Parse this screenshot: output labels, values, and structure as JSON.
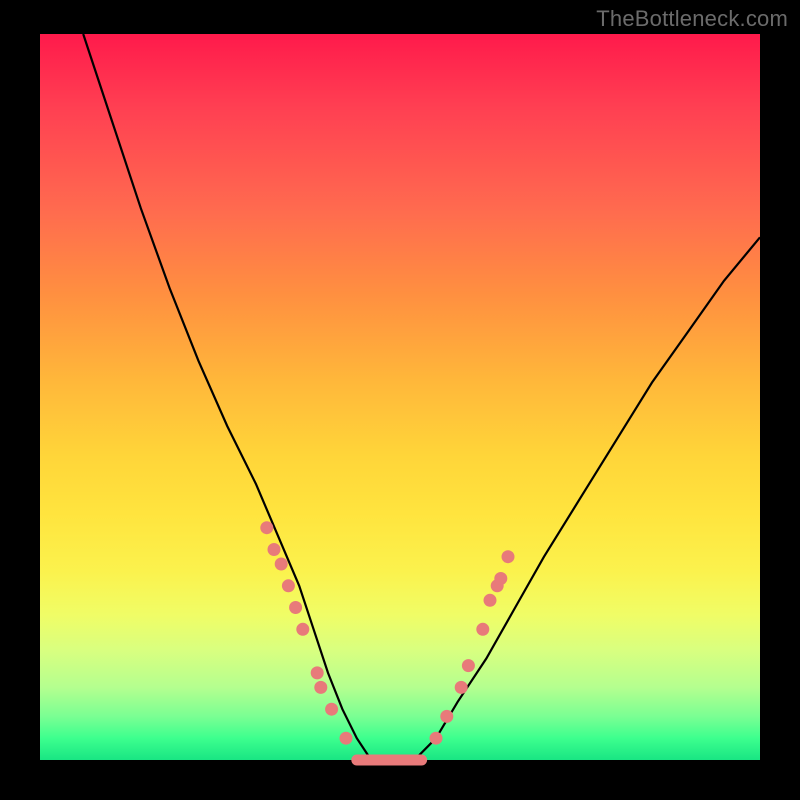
{
  "watermark": "TheBottleneck.com",
  "colors": {
    "dot": "#e87a7a",
    "curve": "#000000",
    "frame": "#000000"
  },
  "chart_data": {
    "type": "line",
    "title": "",
    "xlabel": "",
    "ylabel": "",
    "xlim": [
      0,
      100
    ],
    "ylim": [
      0,
      100
    ],
    "background": "vertical-rainbow-gradient (red→orange→yellow→green)",
    "series": [
      {
        "name": "bottleneck-curve",
        "x": [
          6,
          10,
          14,
          18,
          22,
          26,
          30,
          33,
          36,
          38,
          40,
          42,
          44,
          46,
          48,
          50,
          52,
          55,
          58,
          62,
          66,
          70,
          75,
          80,
          85,
          90,
          95,
          100
        ],
        "y": [
          100,
          88,
          76,
          65,
          55,
          46,
          38,
          31,
          24,
          18,
          12,
          7,
          3,
          0,
          0,
          0,
          0,
          3,
          8,
          14,
          21,
          28,
          36,
          44,
          52,
          59,
          66,
          72
        ]
      }
    ],
    "markers": [
      {
        "x": 31.5,
        "y": 32
      },
      {
        "x": 32.5,
        "y": 29
      },
      {
        "x": 33.5,
        "y": 27
      },
      {
        "x": 34.5,
        "y": 24
      },
      {
        "x": 35.5,
        "y": 21
      },
      {
        "x": 36.5,
        "y": 18
      },
      {
        "x": 38.5,
        "y": 12
      },
      {
        "x": 39.0,
        "y": 10
      },
      {
        "x": 40.5,
        "y": 7
      },
      {
        "x": 42.5,
        "y": 3
      },
      {
        "x": 55.0,
        "y": 3
      },
      {
        "x": 56.5,
        "y": 6
      },
      {
        "x": 58.5,
        "y": 10
      },
      {
        "x": 59.5,
        "y": 13
      },
      {
        "x": 61.5,
        "y": 18
      },
      {
        "x": 62.5,
        "y": 22
      },
      {
        "x": 63.5,
        "y": 24
      },
      {
        "x": 64.0,
        "y": 25
      },
      {
        "x": 65.0,
        "y": 28
      }
    ],
    "flat_minimum": {
      "x_start": 44,
      "x_end": 53,
      "y": 0
    }
  }
}
